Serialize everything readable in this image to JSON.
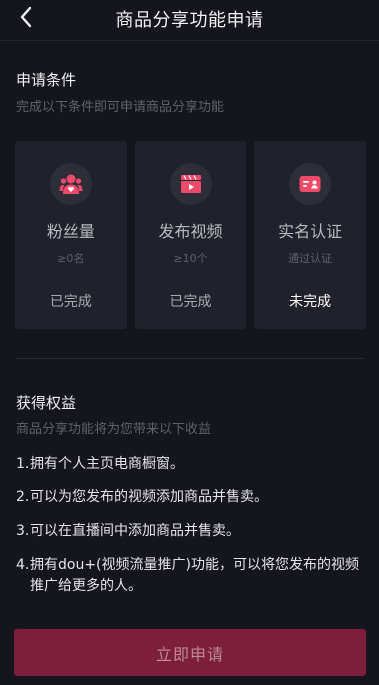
{
  "header": {
    "title": "商品分享功能申请",
    "back_icon": "chevron-left-icon"
  },
  "conditions": {
    "title": "申请条件",
    "subtitle": "完成以下条件即可申请商品分享功能",
    "cards": [
      {
        "icon": "fans-icon",
        "title": "粉丝量",
        "requirement": "≥0名",
        "status": "已完成",
        "done": true
      },
      {
        "icon": "video-icon",
        "title": "发布视频",
        "requirement": "≥10个",
        "status": "已完成",
        "done": true
      },
      {
        "icon": "id-card-icon",
        "title": "实名认证",
        "requirement": "通过认证",
        "status": "未完成",
        "done": false
      }
    ]
  },
  "benefits": {
    "title": "获得权益",
    "subtitle": "商品分享功能将为您带来以下收益",
    "items": [
      {
        "num": "1.",
        "text": "拥有个人主页电商橱窗。"
      },
      {
        "num": "2.",
        "text": "可以为您发布的视频添加商品并售卖。"
      },
      {
        "num": "3.",
        "text": "可以在直播间中添加商品并售卖。"
      },
      {
        "num": "4.",
        "text": "拥有dou+(视频流量推广)功能，可以将您发布的视频推广给更多的人。"
      }
    ]
  },
  "apply_button": {
    "label": "立即申请"
  },
  "colors": {
    "background": "#15161d",
    "card": "#20212a",
    "accent": "#f04a6a",
    "button": "#7d1f3b",
    "button_text": "#bd8a98"
  }
}
